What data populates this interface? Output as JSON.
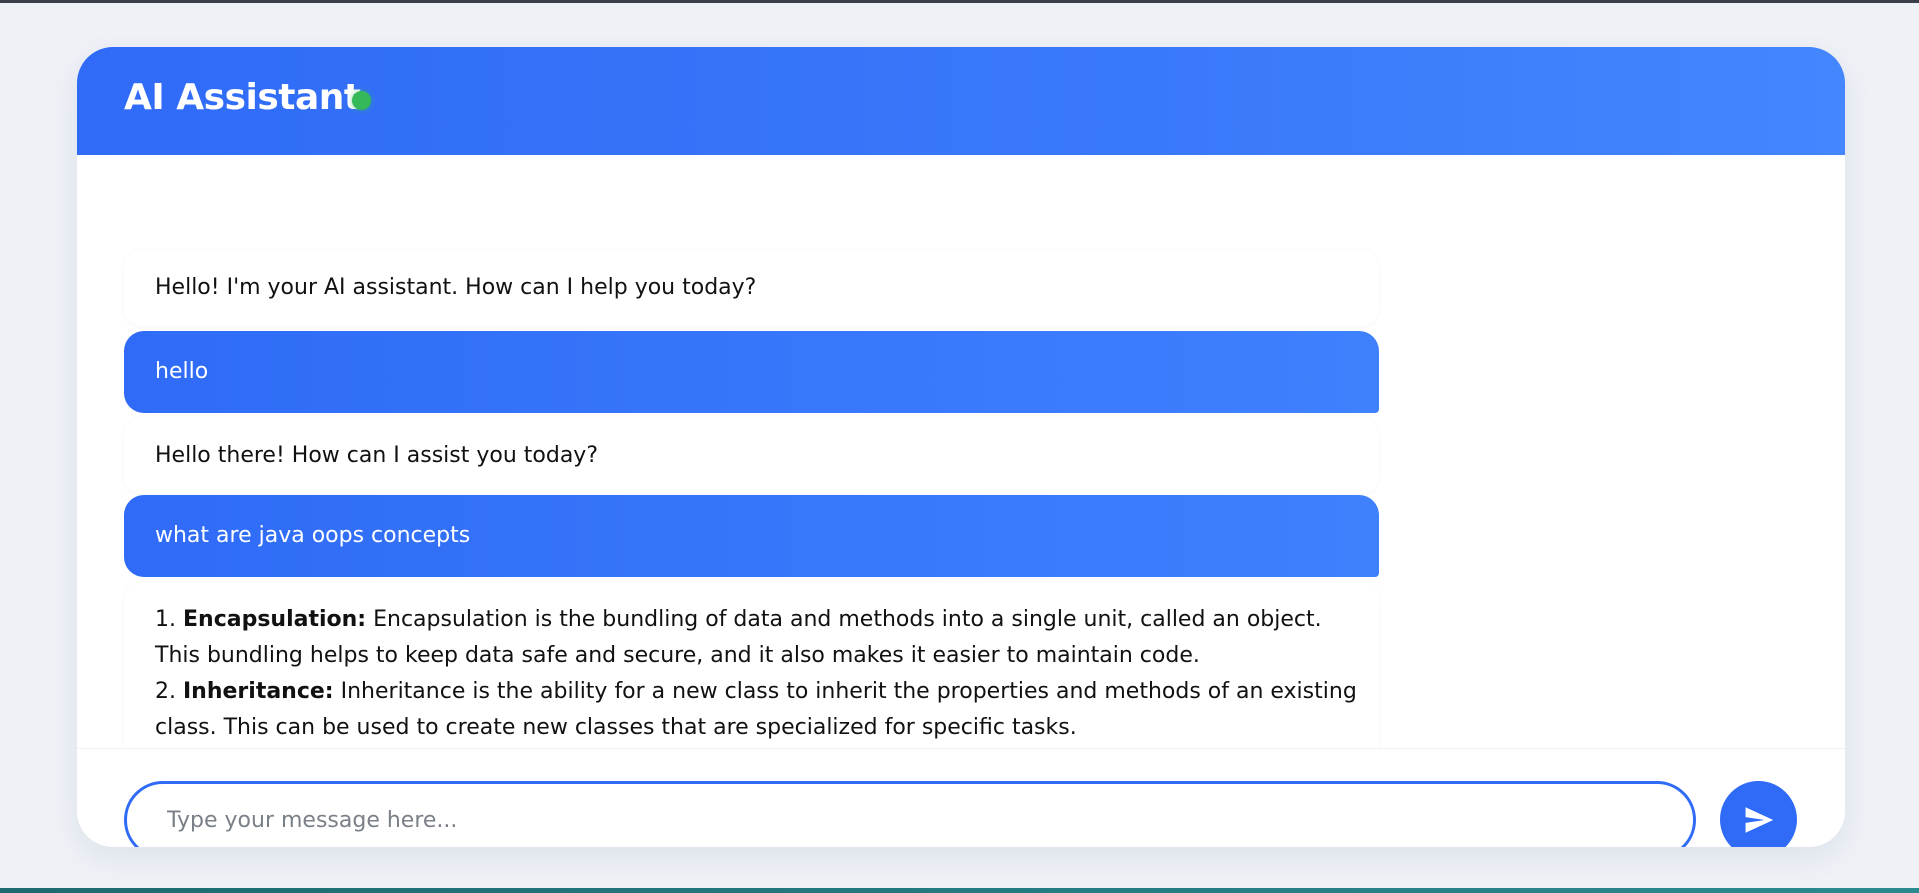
{
  "header": {
    "title": "AI Assistant",
    "status": "online",
    "status_color": "#34b85a",
    "accent_color": "#2f6bf7"
  },
  "messages": [
    {
      "role": "assistant",
      "text": "Hello! I'm your AI assistant. How can I help you today?"
    },
    {
      "role": "user",
      "text": "hello"
    },
    {
      "role": "assistant",
      "text": "Hello there! How can I assist you today?"
    },
    {
      "role": "user",
      "text": "what are java oops concepts"
    },
    {
      "role": "assistant",
      "items": [
        {
          "number": "1.",
          "term": "Encapsulation:",
          "line1": "Encapsulation is the bundling of data and methods into a single unit, called an object.",
          "line2": "This bundling helps to keep data safe and secure, and it also makes it easier to maintain code."
        },
        {
          "number": "2.",
          "term": "Inheritance:",
          "line1": "Inheritance is the ability for a new class to inherit the properties and methods of an existing",
          "line2": "class. This can be used to create new classes that are specialized for specific tasks."
        }
      ]
    }
  ],
  "composer": {
    "placeholder": "Type your message here...",
    "value": "",
    "send_icon": "send-icon"
  }
}
